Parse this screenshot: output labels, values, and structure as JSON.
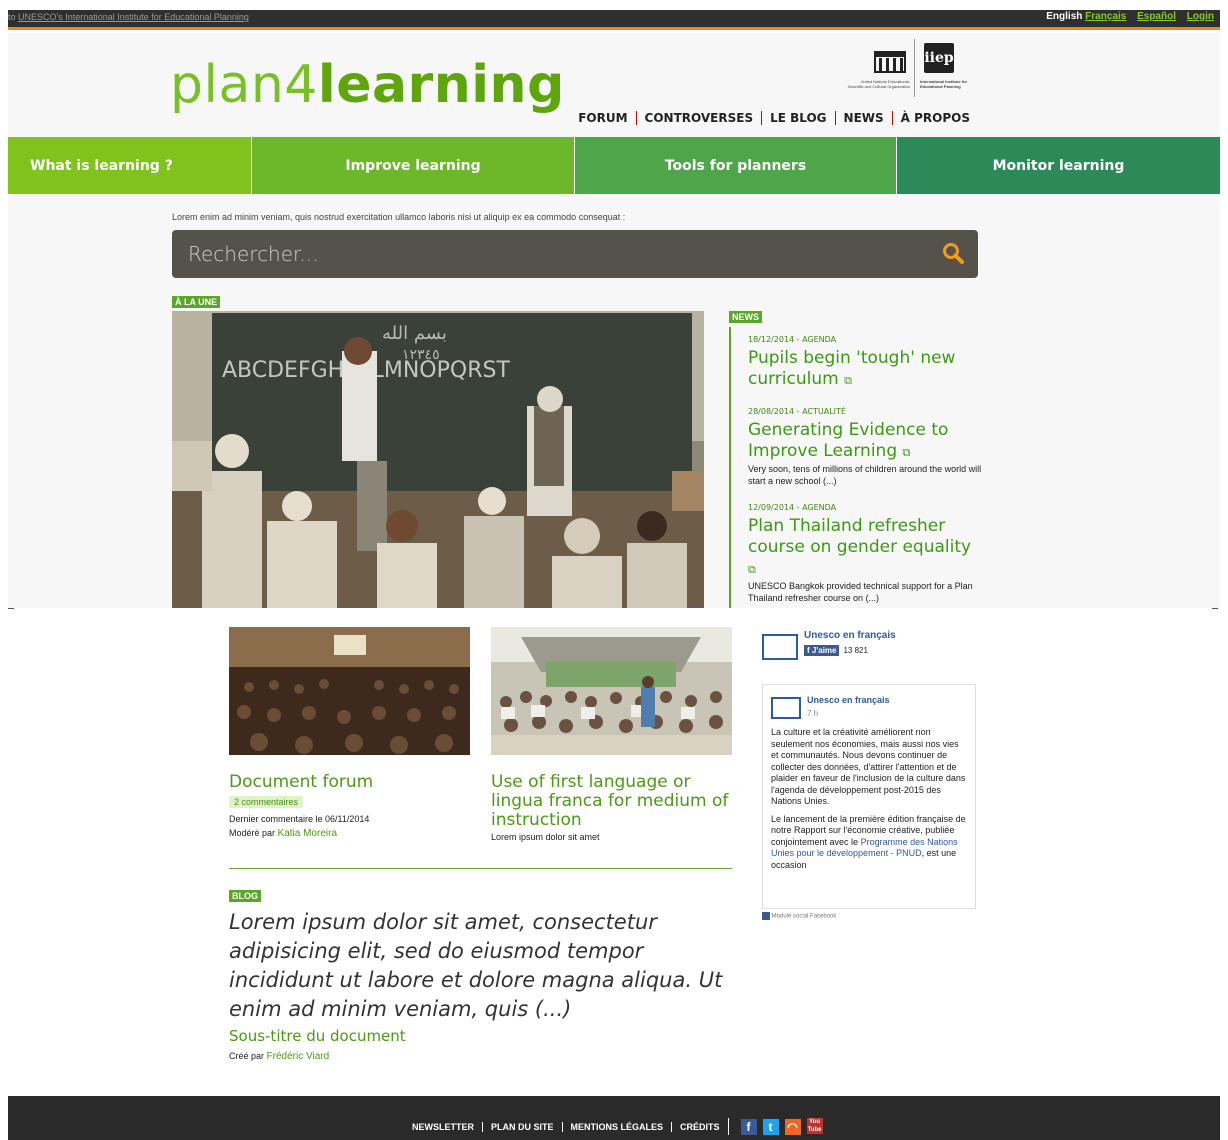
{
  "top_bar": {
    "prefix": "to ",
    "link": "UNESCO's International Institute for Educational Planning",
    "langs": [
      "English",
      "Français",
      "Español",
      "Login"
    ]
  },
  "header": {
    "logo_a": "plan4",
    "logo_b": "learning",
    "unesco_caption": "United Nations Educational, Scientific and Cultural Organization",
    "iiep_caption": "International Institute for Educational Planning",
    "iiep_mark": "iiep",
    "nav": [
      "FORUM",
      "CONTROVERSES",
      "LE BLOG",
      "NEWS",
      "À PROPOS"
    ]
  },
  "main_nav": [
    "What is learning ?",
    "Improve learning",
    "Tools for planners",
    "Monitor learning"
  ],
  "intro": "Lorem enim ad minim veniam, quis nostrud exercitation ullamco laboris nisi ut aliquip ex ea commodo consequat :",
  "search": {
    "placeholder": "Rechercher..."
  },
  "featured": {
    "badge": "À LA UNE"
  },
  "news": {
    "badge": "NEWS",
    "items": [
      {
        "date": "18/12/2014 - AGENDA",
        "title": "Pupils begin 'tough' new curriculum",
        "summary": ""
      },
      {
        "date": "28/08/2014 - ACTUALITÉ",
        "title": "Generating Evidence to Improve Learning",
        "summary": "Very soon, tens of millions of children around the world will start a new school (...)"
      },
      {
        "date": "12/09/2014 - AGENDA",
        "title": "Plan Thailand refresher course on gender equality",
        "summary": "UNESCO Bangkok provided technical support for a Plan Thailand refresher course on (...)"
      }
    ]
  },
  "cards": [
    {
      "title": "Document forum",
      "comments": "2 commentaires",
      "line1": "Dernier commentaire le 06/11/2014",
      "by_label": "Modéré par ",
      "by_name": "Katia Moreira"
    },
    {
      "title": "Use of first language or lingua franca for medium of instruction",
      "line1": "Lorem ipsum dolor sit amet"
    }
  ],
  "blog": {
    "badge": "BLOG",
    "text": "Lorem ipsum dolor sit amet, consectetur adipisicing elit, sed do eiusmod tempor incididunt ut labore et dolore magna aliqua. Ut enim ad minim veniam, quis (...)",
    "subtitle": "Sous-titre du document",
    "by_label": "Créé par ",
    "by_name": "Frédéric Viard"
  },
  "facebook": {
    "page_name": "Unesco en français",
    "like": "J'aime",
    "likes": "13 821",
    "time": "7 h",
    "post1": "La culture et la créativité améliorent non seulement nos économies, mais aussi nos vies et communautés. Nous devons continuer de collecter des données, d'attirer l'attention et de plaider en faveur de l'inclusion de la culture dans l'agenda de développement post-2015 des Nations Unies.",
    "post2a": "Le lancement de la première édition française de notre Rapport sur l'économie créative, publiée conjointement avec le ",
    "post2_link": "Programme des Nations Unies pour le développement - PNUD",
    "post2b": ", est une occasion",
    "footer": "Module social Facebook"
  },
  "footer": {
    "links": [
      "NEWSLETTER",
      "PLAN DU SITE",
      "MENTIONS LÉGALES",
      "CRÉDITS"
    ],
    "social_icons": [
      "facebook-icon",
      "twitter-icon",
      "rss-icon",
      "youtube-icon"
    ],
    "youtube_text": "You Tube"
  },
  "colors": {
    "accent": "#7fc31c",
    "dark_green": "#2c8a58",
    "orange": "#e78b1e",
    "fb_blue": "#3b5998"
  }
}
